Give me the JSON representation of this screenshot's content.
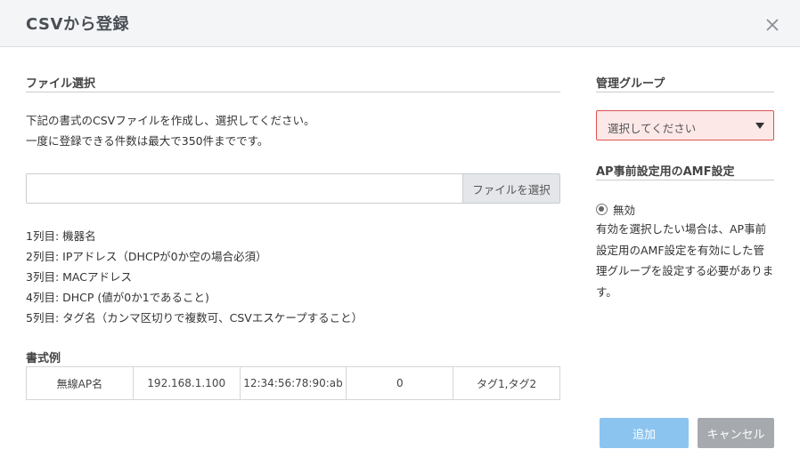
{
  "dialog": {
    "title": "CSVから登録",
    "close_icon": "close-icon"
  },
  "file_section": {
    "heading": "ファイル選択",
    "description": [
      "下記の書式のCSVファイルを作成し、選択してください。",
      "一度に登録できる件数は最大で350件までです。"
    ],
    "file_input_value": "",
    "select_file_button": "ファイルを選択",
    "columns": [
      "1列目: 機器名",
      "2列目: IPアドレス（DHCPが0か空の場合必須）",
      "3列目: MACアドレス",
      "4列目: DHCP (値が0か1であること)",
      "5列目: タグ名（カンマ区切りで複数可、CSVエスケープすること）"
    ],
    "example_heading": "書式例",
    "example_row": [
      "無線AP名",
      "192.168.1.100",
      "12:34:56:78:90:ab",
      "0",
      "タグ1,タグ2"
    ]
  },
  "group_section": {
    "heading": "管理グループ",
    "select_value": "選択してください",
    "select_state_color": "#fde8e8"
  },
  "amf_section": {
    "heading": "AP事前設定用のAMF設定",
    "radio_label": "無効",
    "radio_selected": true,
    "note_lines": [
      "有効を選択したい場合は、AP事前",
      "設定用のAMF設定を有効にした管",
      "理グループを設定する必要がありま",
      "す。"
    ]
  },
  "footer": {
    "add_button": "追加",
    "cancel_button": "キャンセル",
    "add_color": "#8cc4f0",
    "cancel_color": "#a6a9ad"
  }
}
